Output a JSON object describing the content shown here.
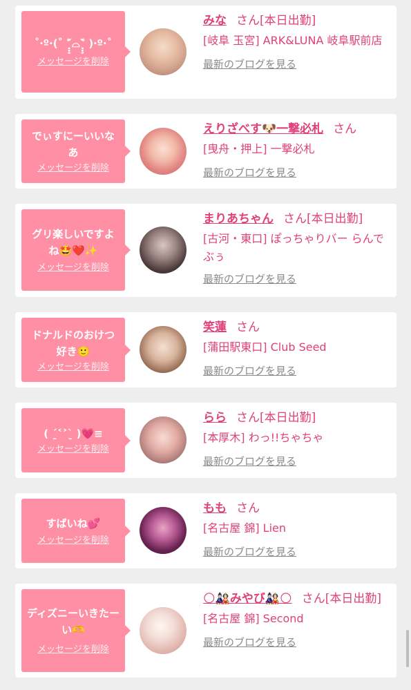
{
  "delete_label": "メッセージを削除",
  "blog_label": "最新のブログを見る",
  "san_suffix": "さん",
  "cards": [
    {
      "message": "˚‧º·(˚ ˃̣̣̥᷄⌓˂̣̣̥᷅ )‧º·˚",
      "name": "みな",
      "status": "[本日出勤]",
      "shop": "[岐阜 玉宮] ARK&LUNA 岐阜駅前店"
    },
    {
      "message": "でぃすにーいいなあ",
      "name": "えりざべす🐶一撃必札",
      "status": "",
      "shop": "[曳舟・押上] 一撃必札"
    },
    {
      "message": "グリ楽しいですよね🤩❤️✨",
      "name": "まりあちゃん",
      "status": "[本日出勤]",
      "shop": "[古河・東口] ぽっちゃりバー らんでぶぅ"
    },
    {
      "message": "ドナルドのおけつ好き🙂",
      "name": "笑蓮",
      "status": "",
      "shop": "[蒲田駅東口] Club Seed"
    },
    {
      "message": "( ˊ̱˂˃ˋ̱ )💗≡",
      "name": "らら",
      "status": "[本日出勤]",
      "shop": "[本厚木] わっ!!ちゃちゃ"
    },
    {
      "message": "すばいね💕",
      "name": "もも",
      "status": "",
      "shop": "[名古屋 錦] Lien"
    },
    {
      "message": "ディズニーいきたーい🫶",
      "name": "🌕🎎みやび🎎🌕",
      "status": "[本日出勤]",
      "shop": "[名古屋 錦] Second"
    }
  ],
  "colors": {
    "accent": "#e0407a",
    "bubble": "#ff8fa4",
    "background": "#eeeeee",
    "link_gray": "#8a8a8a"
  }
}
